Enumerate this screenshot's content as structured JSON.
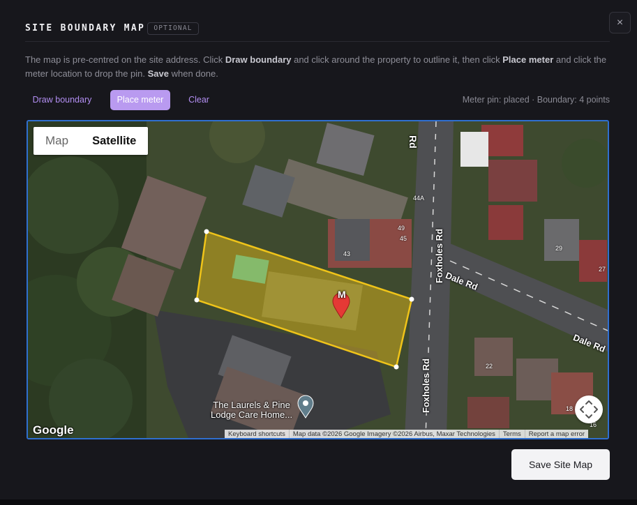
{
  "modal": {
    "title": "SITE BOUNDARY MAP",
    "badge": "OPTIONAL",
    "close_label": "×",
    "description": {
      "p1": "The map is pre-centred on the site address. Click ",
      "b1": "Draw boundary",
      "p2": " and click around the property to outline it, then click ",
      "b2": "Place meter",
      "p3": " and click the meter location to drop the pin. ",
      "b3": "Save",
      "p4": " when done."
    }
  },
  "toolbar": {
    "draw_label": "Draw boundary",
    "place_label": "Place meter",
    "clear_label": "Clear",
    "status": "Meter pin: placed · Boundary: 4 points"
  },
  "map": {
    "type_options": [
      "Map",
      "Satellite"
    ],
    "selected_type": "Satellite",
    "logo": "Google",
    "attribution": [
      "Keyboard shortcuts",
      "Map data ©2026 Google Imagery ©2026 Airbus, Maxar Technologies",
      "Terms",
      "Report a map error"
    ],
    "streets": {
      "foxholes_upper": "Foxholes Rd",
      "foxholes_lower": "Foxholes Rd",
      "dale_1": "Dale Rd",
      "dale_2": "Dale Rd",
      "short_rd": "Rd"
    },
    "poi": {
      "line1": "The Laurels & Pine",
      "line2": "Lodge Care Home..."
    },
    "numbers": [
      "44A",
      "49",
      "45",
      "43",
      "29",
      "27",
      "22",
      "18",
      "16"
    ],
    "meter_pin_letter": "M",
    "boundary_points": 4,
    "colors": {
      "boundary": "#f0c419",
      "pin": "#e53935",
      "map_border": "#2f6fd0"
    }
  },
  "actions": {
    "save_label": "Save Site Map"
  },
  "accent": "#b99af0"
}
